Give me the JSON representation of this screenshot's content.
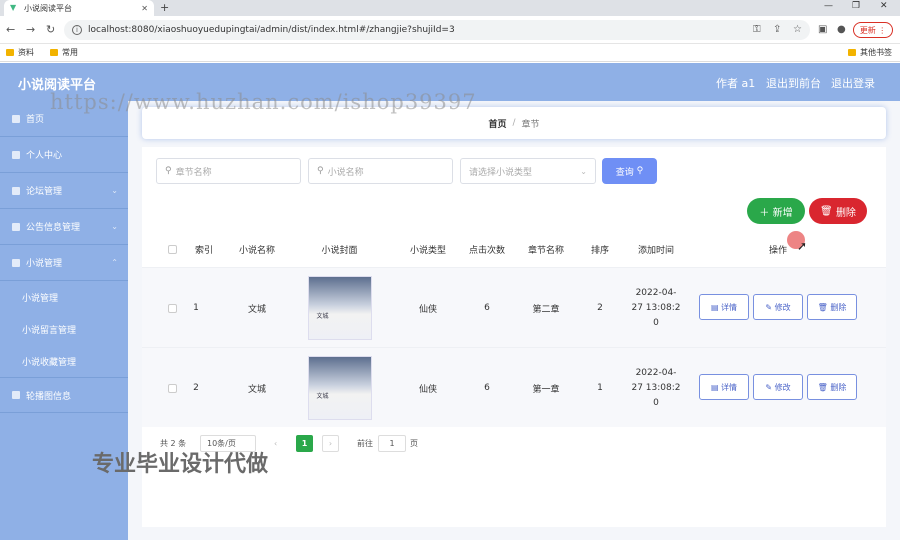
{
  "browser": {
    "tab_title": "小说阅读平台",
    "url": "localhost:8080/xiaoshuoyuedupingtai/admin/dist/index.html#/zhangjie?shujiId=3",
    "update_label": "更新",
    "bookmarks": [
      "资料",
      "常用"
    ],
    "bookmarks_right": "其他书签"
  },
  "header": {
    "brand": "小说阅读平台",
    "user": "作者 a1",
    "back_front": "退出到前台",
    "logout": "退出登录"
  },
  "sidebar": {
    "items": [
      {
        "label": "首页"
      },
      {
        "label": "个人中心"
      },
      {
        "label": "论坛管理"
      },
      {
        "label": "公告信息管理"
      },
      {
        "label": "小说管理"
      }
    ],
    "subitems": [
      {
        "label": "小说管理"
      },
      {
        "label": "小说留言管理"
      },
      {
        "label": "小说收藏管理"
      }
    ],
    "last_item": "轮播图信息"
  },
  "breadcrumb": {
    "home": "首页",
    "sep": "/",
    "current": "章节"
  },
  "search": {
    "chapter_placeholder": "章节名称",
    "novel_placeholder": "小说名称",
    "type_placeholder": "请选择小说类型",
    "query_label": "查询"
  },
  "actions": {
    "add_label": "新增",
    "delete_label": "删除"
  },
  "table": {
    "headers": [
      "索引",
      "小说名称",
      "小说封面",
      "小说类型",
      "点击次数",
      "章节名称",
      "排序",
      "添加时间",
      "操作"
    ],
    "rows": [
      {
        "index": "1",
        "name": "文城",
        "cover_text": "文城",
        "type": "仙侠",
        "clicks": "6",
        "chapter": "第二章",
        "order": "2",
        "time_l1": "2022-04-",
        "time_l2": "27 13:08:2",
        "time_l3": "0"
      },
      {
        "index": "2",
        "name": "文城",
        "cover_text": "文城",
        "type": "仙侠",
        "clicks": "6",
        "chapter": "第一章",
        "order": "1",
        "time_l1": "2022-04-",
        "time_l2": "27 13:08:2",
        "time_l3": "0"
      }
    ],
    "op_labels": {
      "detail": "详情",
      "edit": "修改",
      "delete": "删除"
    }
  },
  "pagination": {
    "total": "共 2 条",
    "page_size": "10条/页",
    "current_page": "1",
    "goto_label": "前往",
    "goto_value": "1",
    "page_unit": "页"
  },
  "watermarks": {
    "url": "https://www.huzhan.com/ishop39397",
    "caption": "专业毕业设计代做"
  }
}
